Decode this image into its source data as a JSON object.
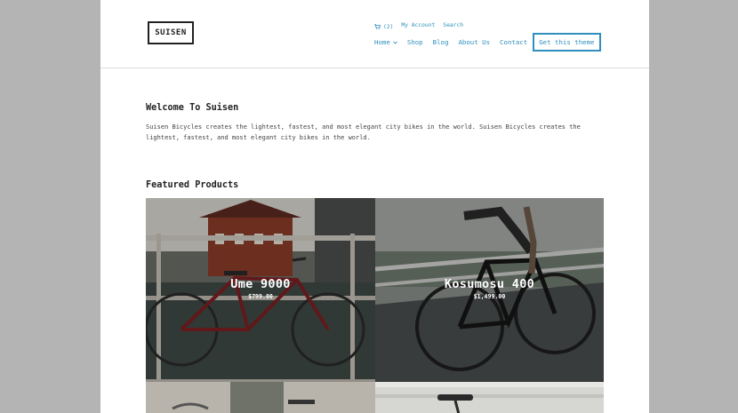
{
  "brand": {
    "logo_text": "SUISEN"
  },
  "topbar": {
    "cart_count": "(2)",
    "my_account": "My Account",
    "search": "Search"
  },
  "nav": {
    "items": [
      {
        "label": "Home"
      },
      {
        "label": "Shop"
      },
      {
        "label": "Blog"
      },
      {
        "label": "About Us"
      },
      {
        "label": "Contact"
      }
    ],
    "cta": "Get this theme"
  },
  "welcome": {
    "title": "Welcome To Suisen",
    "body": "Suisen Bicycles creates the lightest, fastest, and most elegant city bikes in the world. Suisen Bicycles creates the lightest, fastest, and most elegant city bikes in the world."
  },
  "featured": {
    "title": "Featured Products",
    "products": [
      {
        "name": "Ume 9000",
        "price": "$799.00"
      },
      {
        "name": "Kosumosu 400",
        "price": "$1,499.00"
      }
    ]
  },
  "colors": {
    "accent": "#2f8fbf",
    "page_bg": "#b4b4b4",
    "text": "#222222"
  },
  "icons": {
    "cart": "cart-icon",
    "home_dropdown": "chevron-down-icon"
  }
}
